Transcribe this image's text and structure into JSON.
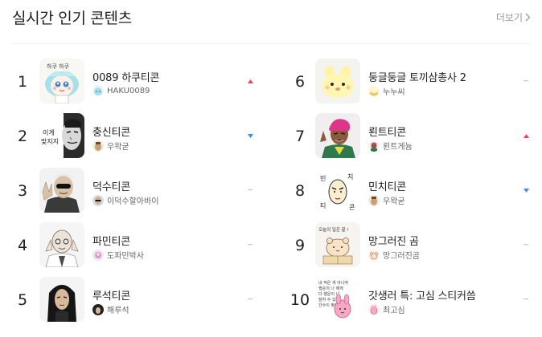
{
  "header": {
    "title": "실시간 인기 콘텐츠",
    "more_label": "더보기"
  },
  "colors": {
    "up": "#f2405a",
    "down": "#3e8bf0",
    "same": "#c7c7c7"
  },
  "items": [
    {
      "rank": "1",
      "name": "0089 하쿠티콘",
      "creator": "HAKU0089",
      "trend": "up",
      "thumb_icon": "haku-character-icon",
      "thumb_text": "하쿠 하쿠"
    },
    {
      "rank": "2",
      "name": "충신티콘",
      "creator": "우왁굳",
      "trend": "down",
      "thumb_icon": "chungsin-character-icon",
      "thumb_text": "이게 맞지지"
    },
    {
      "rank": "3",
      "name": "덕수티콘",
      "creator": "이덕수할아바이",
      "trend": "same",
      "thumb_icon": "deoksu-character-icon"
    },
    {
      "rank": "4",
      "name": "파민티콘",
      "creator": "도파민박사",
      "trend": "same",
      "thumb_icon": "pamin-character-icon"
    },
    {
      "rank": "5",
      "name": "루석티콘",
      "creator": "해루석",
      "trend": "same",
      "thumb_icon": "ruseok-character-icon"
    },
    {
      "rank": "6",
      "name": "둥글둥글 토끼삼총사 2",
      "creator": "누누씨",
      "trend": "same",
      "thumb_icon": "round-rabbit-icon"
    },
    {
      "rank": "7",
      "name": "뢴트티콘",
      "creator": "뢴트게늄",
      "trend": "up",
      "thumb_icon": "roent-character-icon"
    },
    {
      "rank": "8",
      "name": "민치티콘",
      "creator": "우왁굳",
      "trend": "down",
      "thumb_icon": "minchi-character-icon",
      "thumb_text": "민 치 티 콘"
    },
    {
      "rank": "9",
      "name": "망그러진 곰",
      "creator": "망그러진곰",
      "trend": "same",
      "thumb_icon": "broken-bear-icon",
      "thumb_text": "오늘의 일은 끝 !"
    },
    {
      "rank": "10",
      "name": "갓생러 특: 고심 스티커씀",
      "creator": "최고심",
      "trend": "same",
      "thumb_icon": "gosim-character-icon",
      "thumb_text": "내 적은 게 아니여 행운의 나 에게 다 행운이 나 잘하 수 있다 간수이 찾아와"
    }
  ]
}
